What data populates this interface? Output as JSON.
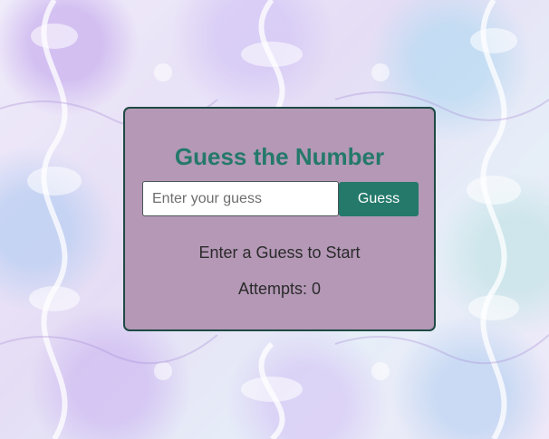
{
  "game": {
    "title": "Guess the Number",
    "input": {
      "placeholder": "Enter your guess",
      "value": ""
    },
    "guess_button_label": "Guess",
    "message": "Enter a Guess to Start",
    "attempts_label": "Attempts: 0"
  },
  "colors": {
    "card_background": "#b498b6",
    "card_border": "#1e4a44",
    "accent": "#24796a",
    "text": "#2b2b2b"
  }
}
